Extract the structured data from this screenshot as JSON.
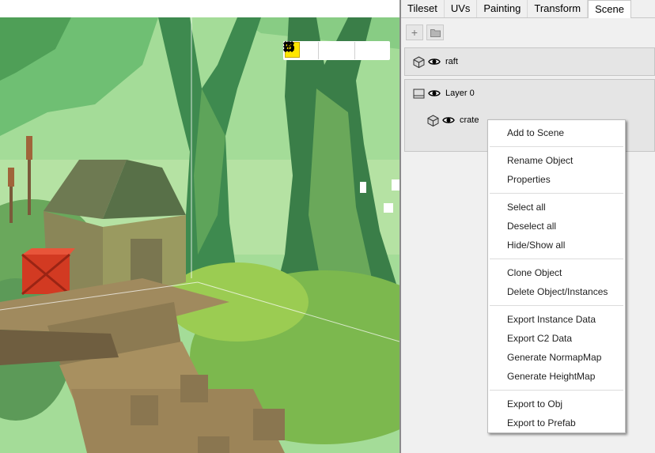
{
  "tabs": [
    {
      "label": "Tileset",
      "active": false
    },
    {
      "label": "UVs",
      "active": false
    },
    {
      "label": "Painting",
      "active": false
    },
    {
      "label": "Transform",
      "active": false
    },
    {
      "label": "Scene",
      "active": true
    }
  ],
  "panel_toolbar": {
    "add_label": "+",
    "open_icon": "folder-icon"
  },
  "scene": {
    "raft": {
      "label": "raft",
      "icon": "cube-icon",
      "visibility_icon": "eye-icon"
    },
    "layer": {
      "label": "Layer 0",
      "icon": "layer-icon",
      "visibility_icon": "eye-icon"
    },
    "crate": {
      "label": "crate",
      "icon": "cube-icon",
      "visibility_icon": "eye-icon"
    }
  },
  "viewport_toolbar": {
    "active_color": "#ffe600",
    "icons": [
      "grid-icon",
      "transform-box-icon",
      "vertex-icon",
      "square-icon",
      "undo-icon",
      "redo-icon"
    ]
  },
  "context_menu": {
    "groups": [
      [
        "Add to Scene"
      ],
      [
        "Rename Object",
        "Properties"
      ],
      [
        "Select all",
        "Deselect all",
        "Hide/Show all"
      ],
      [
        "Clone Object",
        "Delete Object/Instances"
      ],
      [
        "Export Instance Data",
        "Export C2 Data",
        "Generate NormapMap",
        "Generate HeightMap"
      ],
      [
        "Export to Obj",
        "Export to Prefab"
      ]
    ]
  }
}
